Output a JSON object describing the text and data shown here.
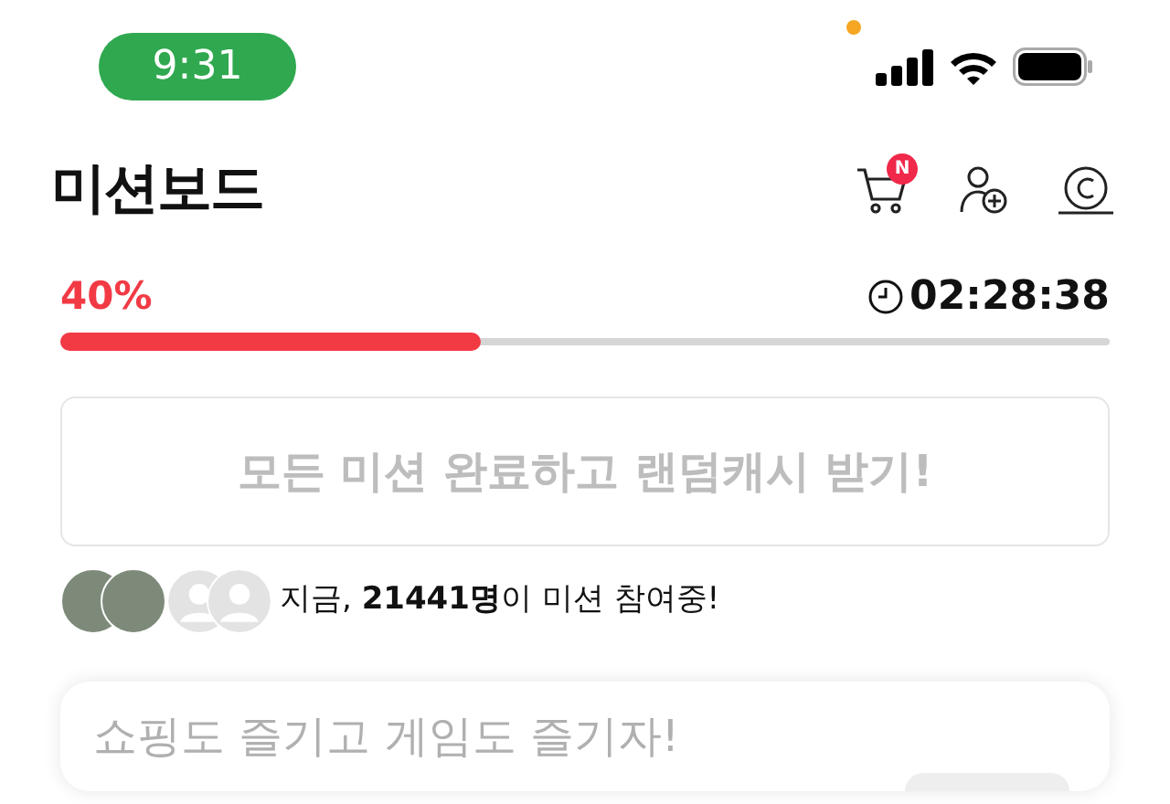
{
  "status_bar": {
    "time": "9:31"
  },
  "header": {
    "title": "미션보드",
    "cart_badge": "N"
  },
  "progress": {
    "percent": "40%",
    "level": 0.4,
    "timer": "02:28:38"
  },
  "reward_button": {
    "label": "모든 미션 완료하고 랜덤캐시 받기!",
    "disabled": true
  },
  "participants": {
    "avatars": [
      {
        "kind": "photo"
      },
      {
        "kind": "photo"
      },
      {
        "kind": "default"
      },
      {
        "kind": "default"
      }
    ],
    "text": "지금, **21441명**이 미션 참여중!"
  },
  "card": {
    "title": "쇼핑도 즐기고 게임도 즐기자!"
  }
}
